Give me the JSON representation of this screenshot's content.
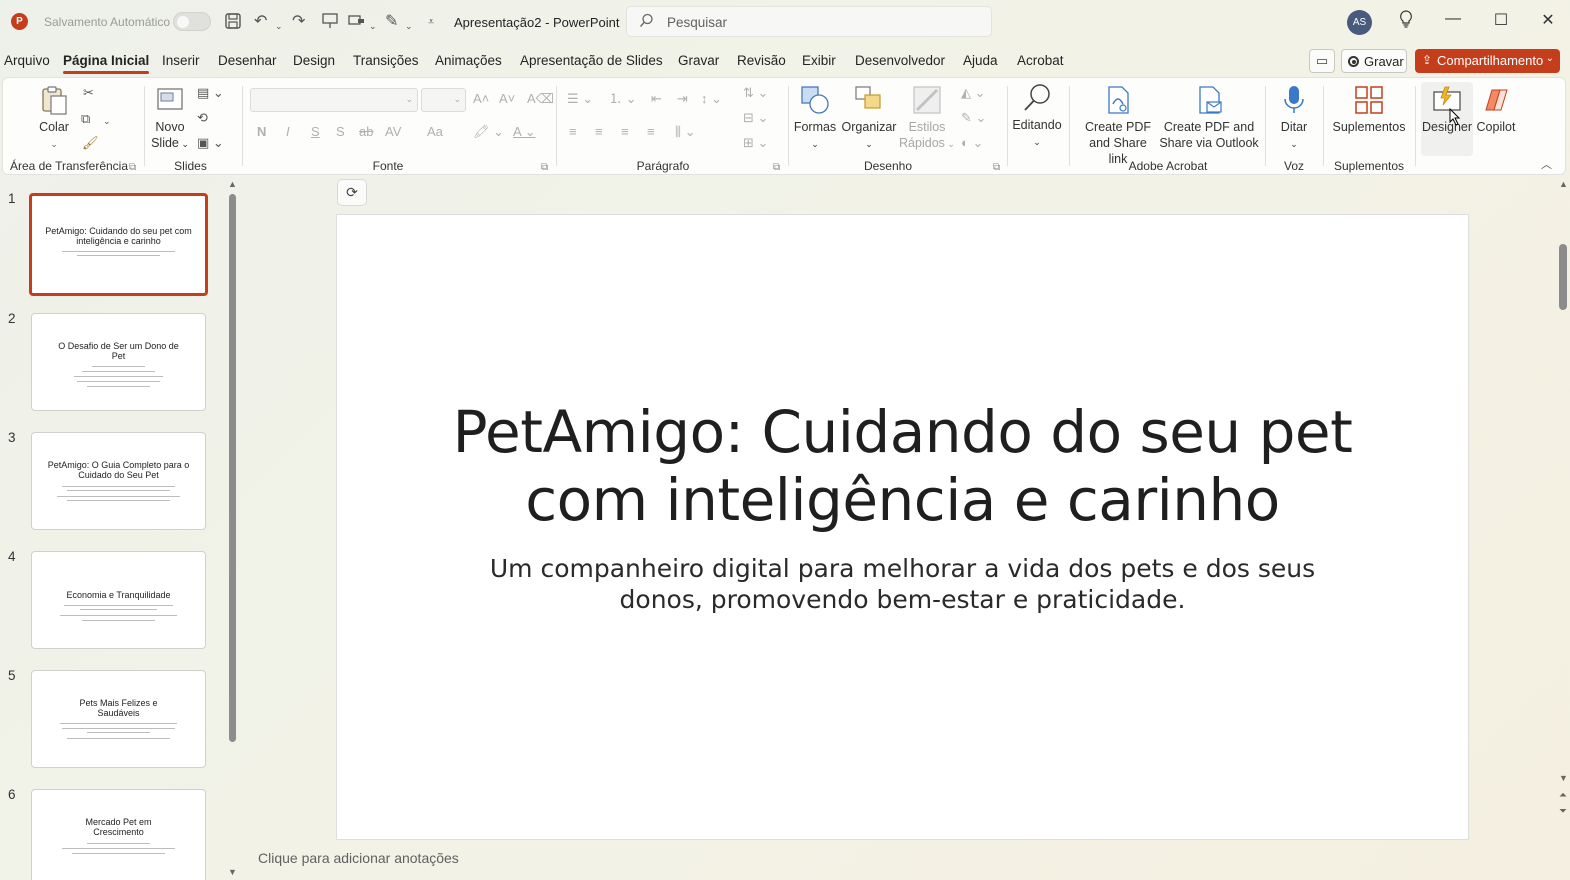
{
  "titlebar": {
    "app_logo": "P",
    "autosave_label": "Salvamento Automático",
    "doc_title": "Apresentação2 - PowerPoint",
    "search_placeholder": "Pesquisar",
    "avatar_initials": "AS",
    "qat_icons": [
      "save-icon",
      "undo-icon",
      "redo-icon",
      "present-from-start-icon",
      "screen-slide-icon",
      "draw-pen-icon",
      "customize-qat-icon"
    ],
    "window_controls": [
      "minimize",
      "maximize",
      "close"
    ]
  },
  "tabs": [
    "Arquivo",
    "Página Inicial",
    "Inserir",
    "Desenhar",
    "Design",
    "Transições",
    "Animações",
    "Apresentação de Slides",
    "Gravar",
    "Revisão",
    "Exibir",
    "Desenvolvedor",
    "Ajuda",
    "Acrobat"
  ],
  "active_tab": "Página Inicial",
  "top_right": {
    "record_label": "Gravar",
    "share_label": "Compartilhamento"
  },
  "ribbon": {
    "clipboard": {
      "paste_label": "Colar",
      "group_label": "Área de Transferência"
    },
    "slides": {
      "new_slide_line1": "Novo",
      "new_slide_line2": "Slide",
      "group_label": "Slides"
    },
    "font": {
      "group_label": "Fonte",
      "bold": "N",
      "italic": "I",
      "underline": "S",
      "shadow": "S",
      "strike": "ab",
      "spacing": "AV",
      "case": "Aa"
    },
    "paragraph": {
      "group_label": "Parágrafo"
    },
    "drawing": {
      "shapes_label": "Formas",
      "arrange_label": "Organizar",
      "quick_styles_line1": "Estilos",
      "quick_styles_line2": "Rápidos",
      "group_label": "Desenho"
    },
    "editing": {
      "label": "Editando"
    },
    "acrobat": {
      "create_pdf_line1": "Create PDF",
      "create_pdf_line2": "and Share link",
      "outlook_line1": "Create PDF and",
      "outlook_line2": "Share via Outlook",
      "group_label": "Adobe Acrobat"
    },
    "voice": {
      "dictate_label": "Ditar",
      "group_label": "Voz"
    },
    "addins": {
      "addins_label": "Suplementos",
      "group_label": "Suplementos"
    },
    "designer_label": "Designer",
    "copilot_label": "Copilot",
    "accent": "#c43e1c"
  },
  "thumbnails": [
    {
      "num": "1",
      "title": "PetAmigo: Cuidando do seu pet com inteligência e carinho",
      "selected": true
    },
    {
      "num": "2",
      "title": "O Desafio de Ser um Dono de Pet",
      "selected": false
    },
    {
      "num": "3",
      "title": "PetAmigo: O Guia Completo para o Cuidado do Seu Pet",
      "selected": false
    },
    {
      "num": "4",
      "title": "Economia e Tranquilidade",
      "selected": false
    },
    {
      "num": "5",
      "title": "Pets Mais Felizes e Saudáveis",
      "selected": false
    },
    {
      "num": "6",
      "title": "Mercado Pet em Crescimento",
      "selected": false
    }
  ],
  "slide": {
    "title": "PetAmigo: Cuidando do seu pet com inteligência e carinho",
    "subtitle": "Um companheiro digital para melhorar a vida dos pets e dos seus donos, promovendo bem-estar e praticidade."
  },
  "notes_placeholder": "Clique para adicionar anotações"
}
